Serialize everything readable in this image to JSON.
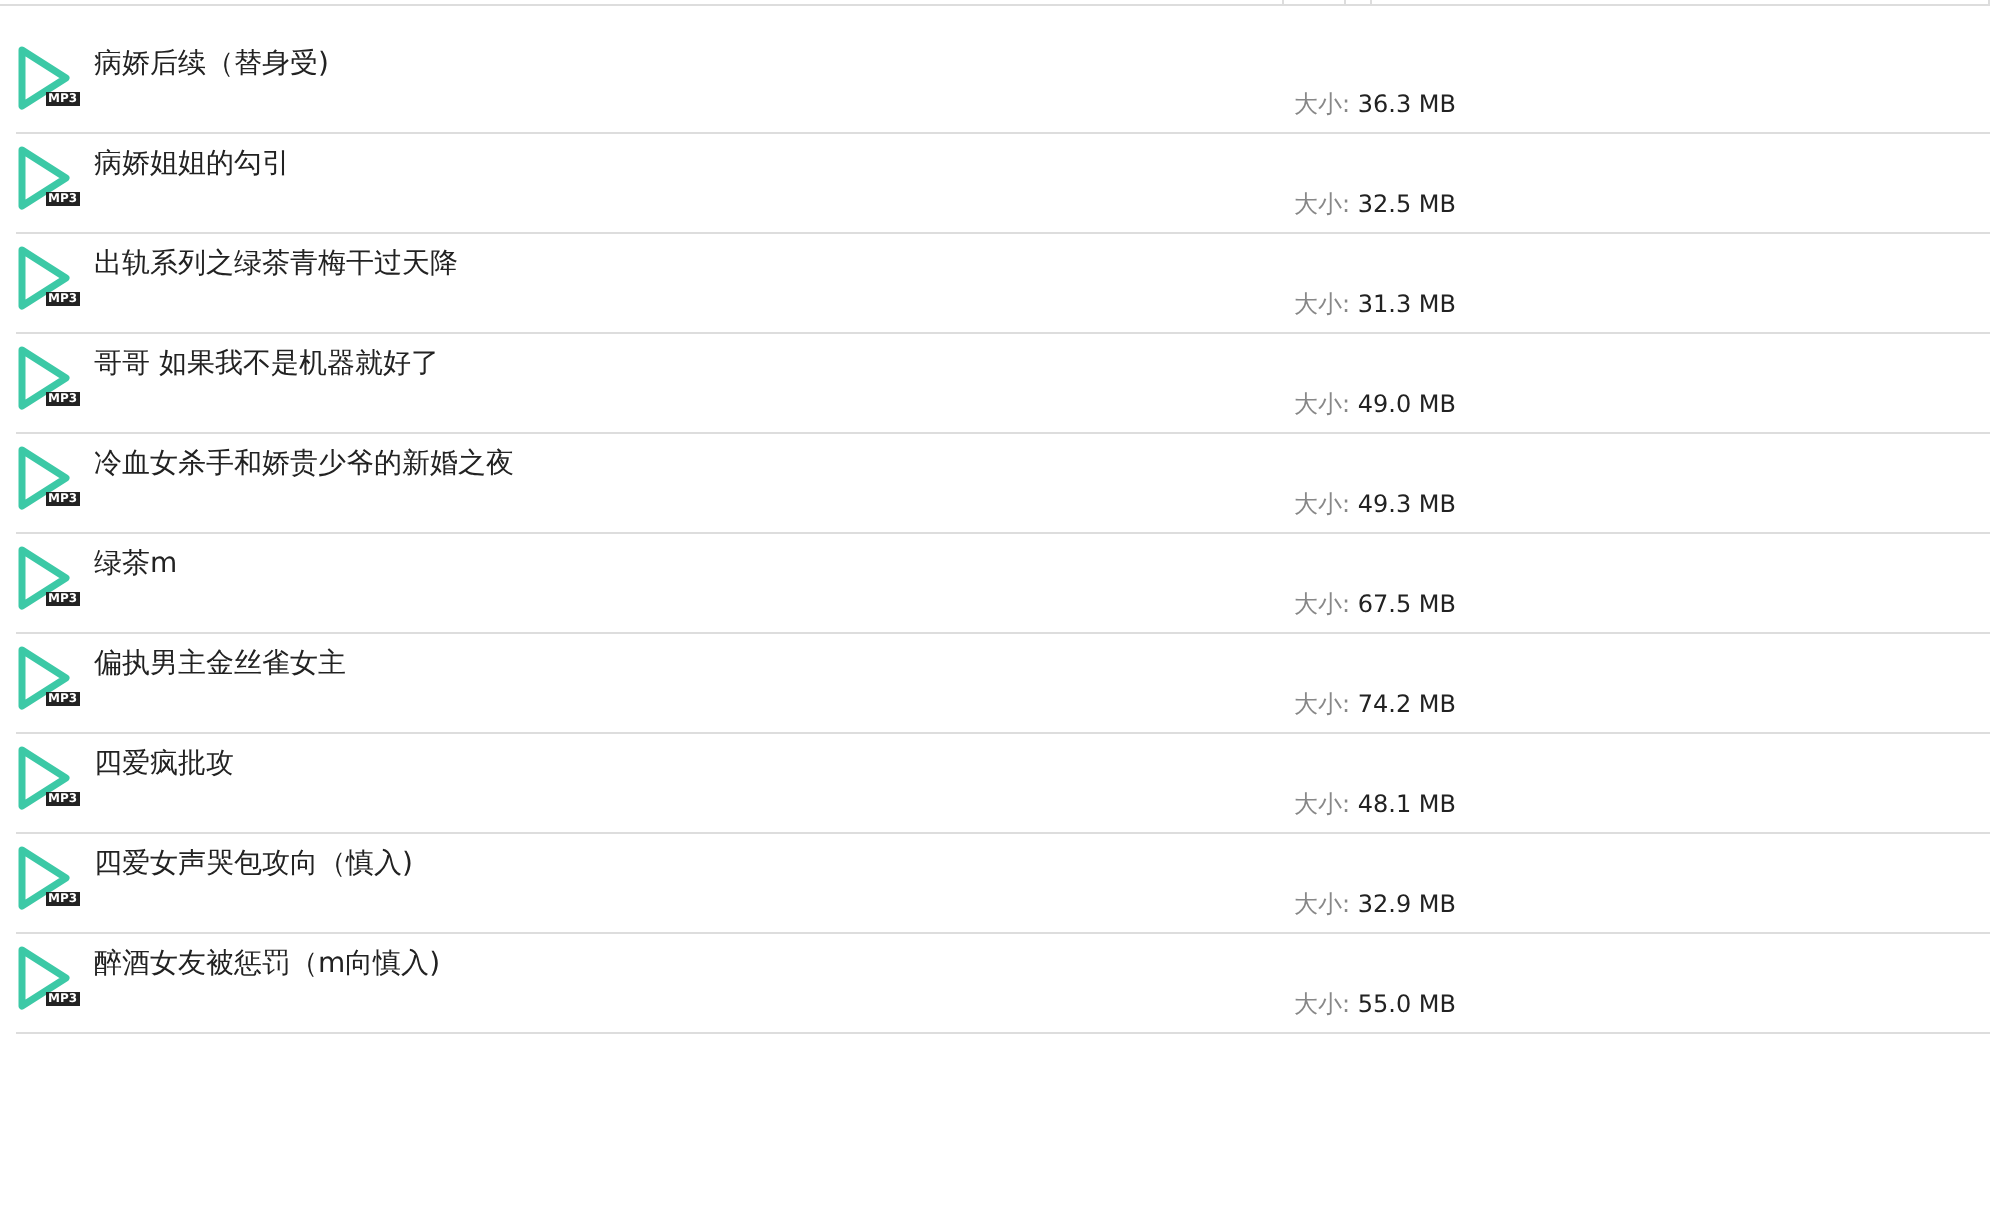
{
  "files": [
    {
      "name": "病娇后续（替身受)",
      "format": "MP3",
      "size_label": "大小:",
      "size": "36.3 MB"
    },
    {
      "name": "病娇姐姐的勾引",
      "format": "MP3",
      "size_label": "大小:",
      "size": "32.5 MB"
    },
    {
      "name": "出轨系列之绿茶青梅干过天降",
      "format": "MP3",
      "size_label": "大小:",
      "size": "31.3 MB"
    },
    {
      "name": "哥哥 如果我不是机器就好了",
      "format": "MP3",
      "size_label": "大小:",
      "size": "49.0 MB"
    },
    {
      "name": "冷血女杀手和娇贵少爷的新婚之夜",
      "format": "MP3",
      "size_label": "大小:",
      "size": "49.3 MB"
    },
    {
      "name": "绿茶m",
      "format": "MP3",
      "size_label": "大小:",
      "size": "67.5 MB"
    },
    {
      "name": "偏执男主金丝雀女主",
      "format": "MP3",
      "size_label": "大小:",
      "size": "74.2 MB"
    },
    {
      "name": "四爱疯批攻",
      "format": "MP3",
      "size_label": "大小:",
      "size": "48.1 MB"
    },
    {
      "name": "四爱女声哭包攻向（慎入)",
      "format": "MP3",
      "size_label": "大小:",
      "size": "32.9 MB"
    },
    {
      "name": "醉酒女友被惩罚（m向慎入)",
      "format": "MP3",
      "size_label": "大小:",
      "size": "55.0 MB"
    }
  ]
}
